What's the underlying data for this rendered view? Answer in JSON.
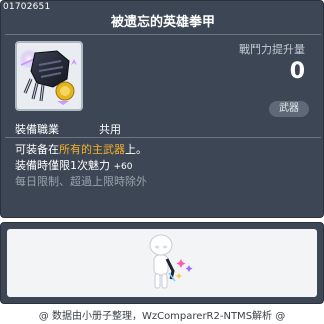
{
  "item": {
    "id": "01702651",
    "name": "被遗忘的英雄拳甲",
    "power_label": "戰鬥力提升量",
    "power_value": "0",
    "category": "武器",
    "req_label": "裝備職業",
    "req_value": "共用",
    "desc_line1_prefix": "可装备在",
    "desc_line1_highlight": "所有的主武器",
    "desc_line1_suffix": "上。",
    "desc_line2_text": "装備時僅限1次魅力",
    "desc_line2_bonus": "+60",
    "desc_line3": "每日限制、超過上限時除外"
  },
  "footer": {
    "text": "@ 数据由小册子整理，WzComparerR2-NTMS解析 @"
  },
  "colors": {
    "panel": "#3c4654",
    "highlight": "#f6b12a",
    "dim_text": "#9aa3ae"
  }
}
